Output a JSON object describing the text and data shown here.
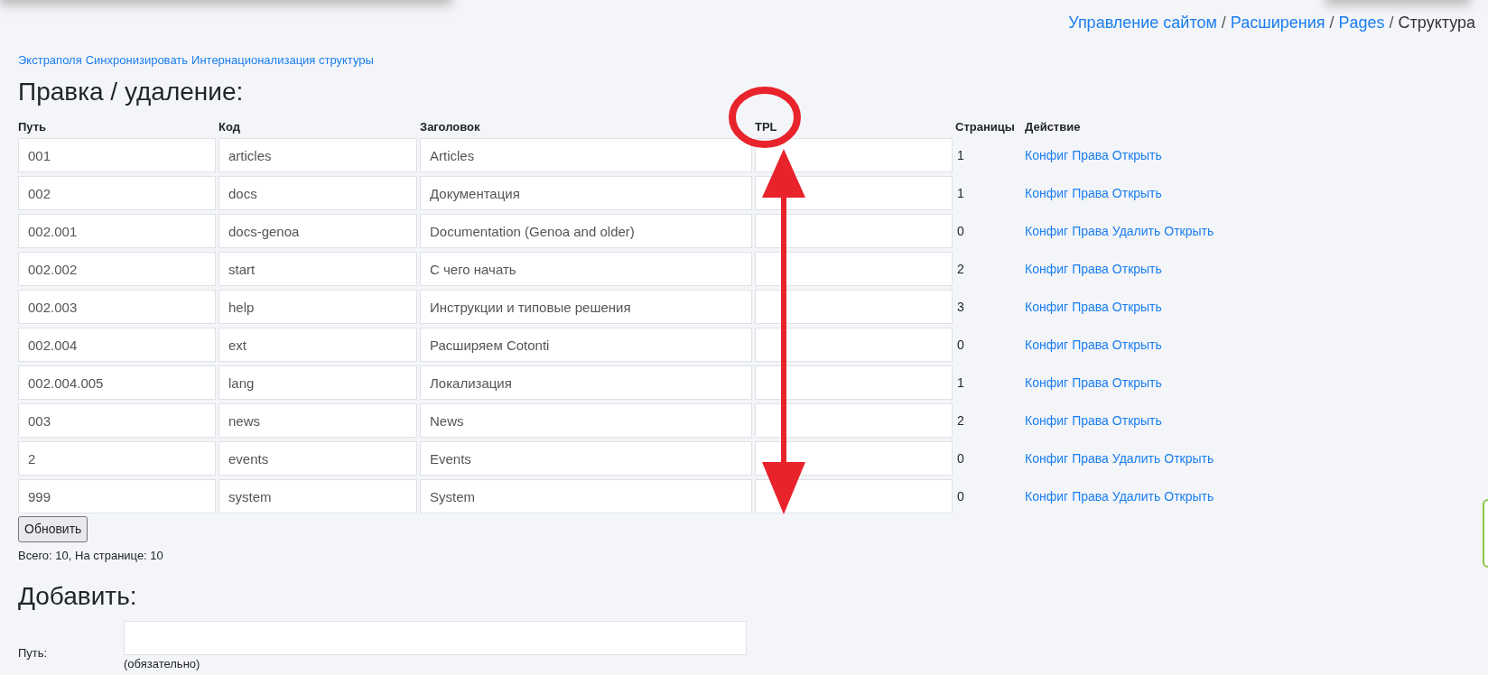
{
  "breadcrumb_separator": "/",
  "breadcrumb": [
    {
      "label": "Управление сайтом",
      "link": true
    },
    {
      "label": "Расширения",
      "link": true
    },
    {
      "label": "Pages",
      "link": true
    },
    {
      "label": "Структура",
      "link": false
    }
  ],
  "toolbar_links": [
    "Экстраполя",
    "Синхронизировать",
    "Интернационализация структуры"
  ],
  "edit_heading": "Правка / удаление:",
  "table": {
    "columns": [
      "Путь",
      "Код",
      "Заголовок",
      "TPL",
      "Страницы",
      "Действие"
    ],
    "rows": [
      {
        "path": "001",
        "code": "articles",
        "title": "Articles",
        "pages": "1",
        "actions": [
          "Конфиг",
          "Права",
          "Открыть"
        ]
      },
      {
        "path": "002",
        "code": "docs",
        "title": "Документация",
        "pages": "1",
        "actions": [
          "Конфиг",
          "Права",
          "Открыть"
        ]
      },
      {
        "path": "002.001",
        "code": "docs-genoa",
        "title": "Documentation (Genoa and older)",
        "pages": "0",
        "actions": [
          "Конфиг",
          "Права",
          "Удалить",
          "Открыть"
        ]
      },
      {
        "path": "002.002",
        "code": "start",
        "title": "С чего начать",
        "pages": "2",
        "actions": [
          "Конфиг",
          "Права",
          "Открыть"
        ]
      },
      {
        "path": "002.003",
        "code": "help",
        "title": "Инструкции и типовые решения",
        "pages": "3",
        "actions": [
          "Конфиг",
          "Права",
          "Открыть"
        ]
      },
      {
        "path": "002.004",
        "code": "ext",
        "title": "Расширяем Cotonti",
        "pages": "0",
        "actions": [
          "Конфиг",
          "Права",
          "Открыть"
        ]
      },
      {
        "path": "002.004.005",
        "code": "lang",
        "title": "Локализация",
        "pages": "1",
        "actions": [
          "Конфиг",
          "Права",
          "Открыть"
        ]
      },
      {
        "path": "003",
        "code": "news",
        "title": "News",
        "pages": "2",
        "actions": [
          "Конфиг",
          "Права",
          "Открыть"
        ]
      },
      {
        "path": "2",
        "code": "events",
        "title": "Events",
        "pages": "0",
        "actions": [
          "Конфиг",
          "Права",
          "Удалить",
          "Открыть"
        ]
      },
      {
        "path": "999",
        "code": "system",
        "title": "System",
        "pages": "0",
        "actions": [
          "Конфиг",
          "Права",
          "Удалить",
          "Открыть"
        ]
      }
    ]
  },
  "update_button": "Обновить",
  "summary": "Всего: 10, На странице: 10",
  "add_heading": "Добавить:",
  "add_form": {
    "label": "Путь:",
    "note": "(обязательно)"
  }
}
